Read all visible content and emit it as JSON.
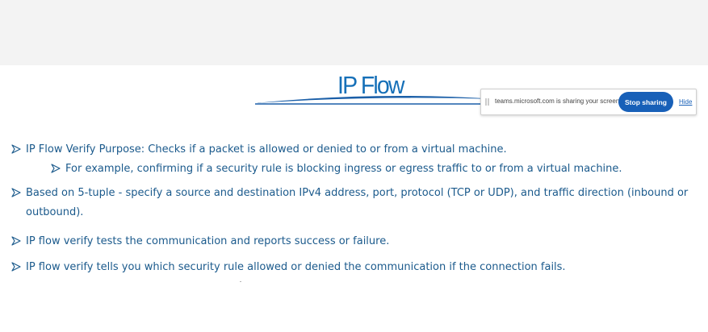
{
  "slide": {
    "title": "IP Flow",
    "title_color": "#1670b8",
    "bullet_color": "#1b5a8c",
    "bullets": [
      "IP Flow Verify Purpose: Checks if a packet is allowed or denied to or from a virtual machine.",
      "For example, confirming if a security rule is blocking ingress or egress traffic to or from a virtual machine.",
      "Based on 5-tuple - specify  a source and destination IPv4 address, port, protocol (TCP or UDP), and traffic direction (inbound or outbound).",
      "IP flow verify tests the communication and reports success or failure.",
      "IP flow verify tells you which security rule allowed or denied the communication if the connection fails."
    ]
  },
  "share_bar": {
    "message": "teams.microsoft.com is sharing your screen.",
    "stop_label": "Stop sharing",
    "hide_label": "Hide",
    "button_color": "#1860b8"
  }
}
